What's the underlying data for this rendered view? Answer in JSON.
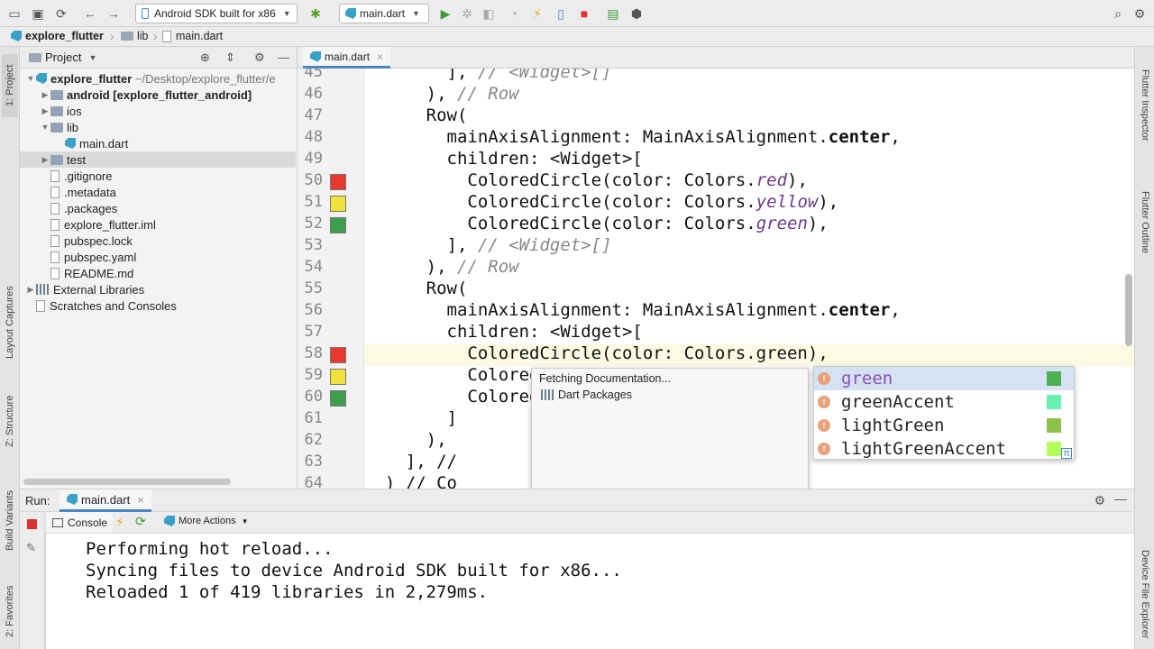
{
  "toolbar": {
    "device_label": "Android SDK built for x86",
    "file_label": "main.dart"
  },
  "breadcrumb": {
    "items": [
      "explore_flutter",
      "lib",
      "main.dart"
    ]
  },
  "left_tabs": [
    "1: Project",
    "Layout Captures",
    "Z: Structure",
    "Build Variants",
    "2: Favorites"
  ],
  "right_tabs": [
    "Flutter Inspector",
    "Flutter Outline",
    "Device File Explorer"
  ],
  "project": {
    "title": "Project",
    "tree": [
      {
        "label": "explore_flutter",
        "suffix": " ~/Desktop/explore_flutter/e",
        "type": "root",
        "indent": 0,
        "twisty": "▼"
      },
      {
        "label": "android",
        "suffix": " [explore_flutter_android]",
        "type": "folder",
        "indent": 1,
        "twisty": "▶"
      },
      {
        "label": "ios",
        "suffix": "",
        "type": "folder",
        "indent": 1,
        "twisty": "▶"
      },
      {
        "label": "lib",
        "suffix": "",
        "type": "folder",
        "indent": 1,
        "twisty": "▼"
      },
      {
        "label": "main.dart",
        "suffix": "",
        "type": "dart",
        "indent": 2,
        "twisty": ""
      },
      {
        "label": "test",
        "suffix": "",
        "type": "folder",
        "indent": 1,
        "twisty": "▶"
      },
      {
        "label": ".gitignore",
        "suffix": "",
        "type": "file",
        "indent": 1,
        "twisty": ""
      },
      {
        "label": ".metadata",
        "suffix": "",
        "type": "file",
        "indent": 1,
        "twisty": ""
      },
      {
        "label": ".packages",
        "suffix": "",
        "type": "file",
        "indent": 1,
        "twisty": ""
      },
      {
        "label": "explore_flutter.iml",
        "suffix": "",
        "type": "file",
        "indent": 1,
        "twisty": ""
      },
      {
        "label": "pubspec.lock",
        "suffix": "",
        "type": "file",
        "indent": 1,
        "twisty": ""
      },
      {
        "label": "pubspec.yaml",
        "suffix": "",
        "type": "file",
        "indent": 1,
        "twisty": ""
      },
      {
        "label": "README.md",
        "suffix": "",
        "type": "file",
        "indent": 1,
        "twisty": ""
      },
      {
        "label": "External Libraries",
        "suffix": "",
        "type": "lib",
        "indent": 0,
        "twisty": "▶"
      },
      {
        "label": "Scratches and Consoles",
        "suffix": "",
        "type": "scratch",
        "indent": 0,
        "twisty": ""
      }
    ]
  },
  "editor": {
    "tab_label": "main.dart",
    "lines": [
      {
        "n": "45",
        "parts": [
          [
            "        ], ",
            ""
          ],
          [
            "// <Widget>[]",
            "cm"
          ]
        ]
      },
      {
        "n": "46",
        "parts": [
          [
            "      ), ",
            ""
          ],
          [
            "// Row",
            "cm"
          ]
        ]
      },
      {
        "n": "47",
        "parts": [
          [
            "      Row(",
            ""
          ]
        ]
      },
      {
        "n": "48",
        "parts": [
          [
            "        mainAxisAlignment: MainAxisAlignment.",
            ""
          ],
          [
            "center",
            "bd"
          ],
          [
            ",",
            ""
          ]
        ]
      },
      {
        "n": "49",
        "parts": [
          [
            "        children: <Widget>[",
            ""
          ]
        ]
      },
      {
        "n": "50",
        "parts": [
          [
            "          ColoredCircle(color: Colors.",
            ""
          ],
          [
            "red",
            "it"
          ],
          [
            "),",
            ""
          ]
        ],
        "swatch": "#e8392f"
      },
      {
        "n": "51",
        "parts": [
          [
            "          ColoredCircle(color: Colors.",
            ""
          ],
          [
            "yellow",
            "it"
          ],
          [
            "),",
            ""
          ]
        ],
        "swatch": "#f2e13c"
      },
      {
        "n": "52",
        "parts": [
          [
            "          ColoredCircle(color: Colors.",
            ""
          ],
          [
            "green",
            "it"
          ],
          [
            "),",
            ""
          ]
        ],
        "swatch": "#3f9e4d"
      },
      {
        "n": "53",
        "parts": [
          [
            "        ], ",
            ""
          ],
          [
            "// <Widget>[]",
            "cm"
          ]
        ]
      },
      {
        "n": "54",
        "parts": [
          [
            "      ), ",
            ""
          ],
          [
            "// Row",
            "cm"
          ]
        ]
      },
      {
        "n": "55",
        "parts": [
          [
            "      Row(",
            ""
          ]
        ]
      },
      {
        "n": "56",
        "parts": [
          [
            "        mainAxisAlignment: MainAxisAlignment.",
            ""
          ],
          [
            "center",
            "bd"
          ],
          [
            ",",
            ""
          ]
        ]
      },
      {
        "n": "57",
        "parts": [
          [
            "        children: <Widget>[",
            ""
          ]
        ]
      },
      {
        "n": "58",
        "parts": [
          [
            "          ColoredCircle(color: Colors.green),",
            ""
          ]
        ],
        "swatch": "#e8392f"
      },
      {
        "n": "59",
        "parts": [
          [
            "          ColoredCircle(color: Colors.",
            ""
          ]
        ],
        "swatch": "#f2e13c"
      },
      {
        "n": "60",
        "parts": [
          [
            "          ColoredCircle(color: Colors.",
            ""
          ]
        ],
        "swatch": "#3f9e4d"
      },
      {
        "n": "61",
        "parts": [
          [
            "        ]",
            ""
          ]
        ]
      },
      {
        "n": "62",
        "parts": [
          [
            "      ),",
            ""
          ]
        ]
      },
      {
        "n": "63",
        "parts": [
          [
            "    ], //",
            ""
          ]
        ]
      },
      {
        "n": "64",
        "parts": [
          [
            "  ) // Co",
            ""
          ]
        ]
      }
    ]
  },
  "doc_popup": {
    "status": "Fetching Documentation...",
    "source": "Dart Packages"
  },
  "completion": {
    "items": [
      {
        "label": "green",
        "color": "#4caf50",
        "selected": true
      },
      {
        "label": "greenAccent",
        "color": "#69f0ae",
        "selected": false
      },
      {
        "label": "lightGreen",
        "color": "#8bc34a",
        "selected": false
      },
      {
        "label": "lightGreenAccent",
        "color": "#b2ff59",
        "selected": false
      }
    ],
    "footer_glyph": "π"
  },
  "run": {
    "label": "Run:",
    "tab_label": "main.dart",
    "console_tab": "Console",
    "more_actions": "More Actions",
    "output": [
      "Performing hot reload...",
      "Syncing files to device Android SDK built for x86...",
      "Reloaded 1 of 419 libraries in 2,279ms."
    ]
  }
}
